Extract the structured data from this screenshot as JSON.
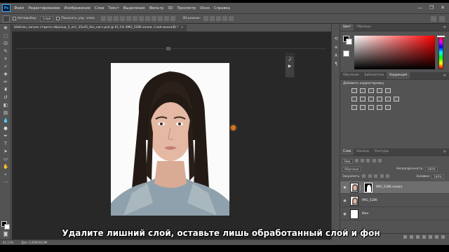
{
  "app": {
    "logo": "Ps",
    "menu": [
      "Файл",
      "Редактирование",
      "Изображение",
      "Слои",
      "Текст",
      "Выделение",
      "Фильтр",
      "3D",
      "Просмотр",
      "Окно",
      "Справка"
    ],
    "window_controls": [
      "—",
      "❐",
      "✕"
    ]
  },
  "options": {
    "autoselect_label": "Автовыбор:",
    "autoselect_value": "Слой",
    "transform_label": "Показать упр. элем.",
    "mode3d_label": "3D-режим:"
  },
  "document": {
    "tab_title": "Шаблон_загран старого образца_5_лет_35х45_без_нагн.psd @ 61,1% (IMG_5286 копия, Слой-маска/8) *",
    "close_glyph": "×"
  },
  "status": {
    "zoom": "61,11%",
    "doc_size": "Док: 2,92М/36,0М"
  },
  "subtitle": "Удалите лишний слой, оставьте лишь обработанный слой и фон",
  "panels": {
    "color_tabs": [
      "Цвет",
      "Образцы"
    ],
    "adjust_tabs": [
      "Обучение",
      "Библиотеки",
      "Коррекция"
    ],
    "adjust_title": "Добавить корректировку",
    "layers_tabs": [
      "Слои",
      "Каналы",
      "Контуры"
    ],
    "layers_kind": "Вид",
    "blend_mode": "Обычные",
    "opacity_label": "Непрозрачность:",
    "opacity_value": "100%",
    "lock_label": "Закрепить:",
    "fill_label": "Заливка:",
    "fill_value": "100%",
    "layers": [
      {
        "name": "IMG_5286 копия",
        "selected": true,
        "mask": true
      },
      {
        "name": "IMG_5286",
        "selected": false,
        "mask": false
      },
      {
        "name": "Фон",
        "selected": false,
        "mask": false
      }
    ]
  },
  "colors": {
    "accent": "#31a8ff",
    "canvas_bg": "#282828",
    "ui_bg": "#535353"
  }
}
